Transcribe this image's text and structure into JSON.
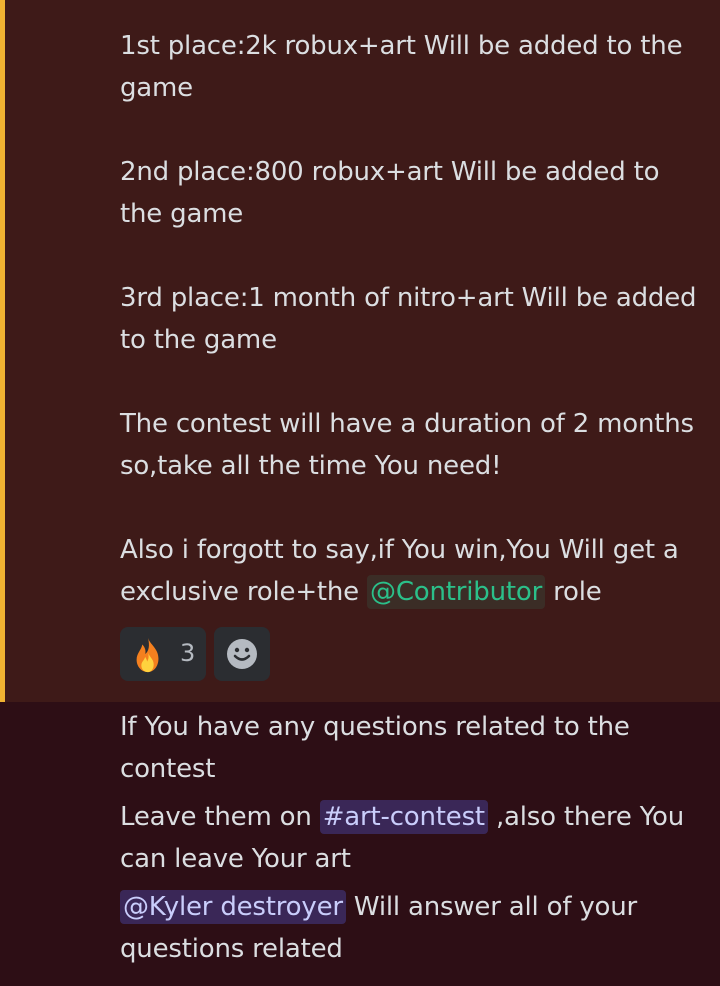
{
  "messages": {
    "first_place": "1st place:2k robux+art Will be added to the game",
    "second_place": "2nd place:800 robux+art Will be added to the game",
    "third_place": "3rd place:1 month of nitro+art Will be added to the game",
    "duration": "The contest will have a duration of 2 months so,take all the time You need!",
    "role_note": {
      "before": "Also i forgott to say,if You win,You Will get a exclusive role+the ",
      "mention": "@Contributor",
      "after": " role"
    },
    "questions": "If You have any questions related to the contest",
    "leave": {
      "before": "Leave them on ",
      "mention": "#art-contest",
      "after": " ,also there You can leave Your art"
    },
    "answer": {
      "mention": "@Kyler destroyer",
      "after": " Will answer all of your questions related"
    }
  },
  "reactions": [
    {
      "emoji": "fire-icon",
      "count": "3"
    }
  ],
  "colors": {
    "highlight_bg": "#3e1a18",
    "mention_stripe": "#f0b232",
    "page_bg": "#2d0e15",
    "text": "#dbdee1",
    "role_mention": "#2bc08a",
    "user_mention": "#c9cdfb"
  }
}
